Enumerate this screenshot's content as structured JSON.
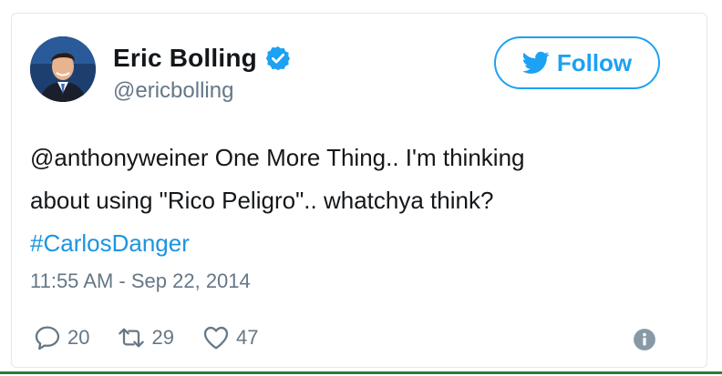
{
  "user": {
    "display_name": "Eric Bolling",
    "handle": "@ericbolling",
    "verified": true
  },
  "follow_button": {
    "label": "Follow",
    "icon": "twitter-bird-icon"
  },
  "tweet": {
    "line1": "@anthonyweiner One More Thing.. I'm thinking",
    "line2": "about using \"Rico Peligro\".. whatchya think?",
    "hashtag": "#CarlosDanger",
    "timestamp": "11:55 AM - Sep 22, 2014"
  },
  "actions": {
    "replies": "20",
    "retweets": "29",
    "likes": "47"
  },
  "colors": {
    "accent": "#1da1f2",
    "link": "#1b95e0",
    "muted": "#657786",
    "text": "#14171a",
    "border": "#e1e8ed"
  }
}
